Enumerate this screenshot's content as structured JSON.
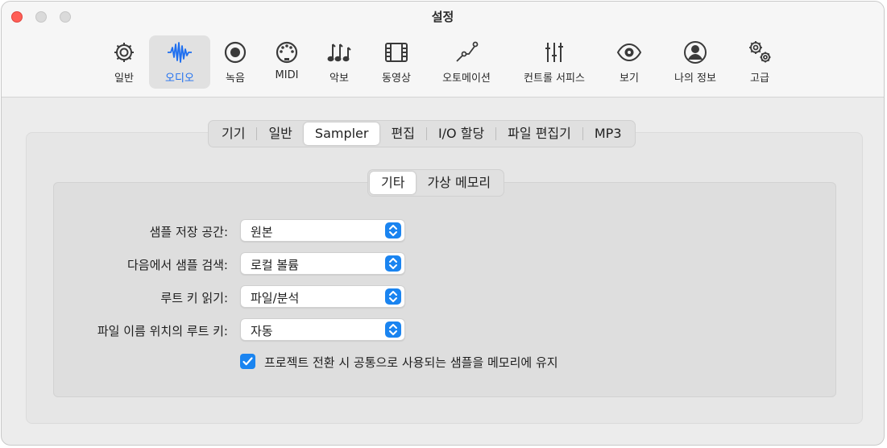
{
  "window": {
    "title": "설정"
  },
  "toolbar": {
    "items": [
      {
        "label": "일반",
        "icon": "gear-icon"
      },
      {
        "label": "오디오",
        "icon": "waveform-icon",
        "active": true
      },
      {
        "label": "녹음",
        "icon": "record-icon"
      },
      {
        "label": "MIDI",
        "icon": "midi-port-icon"
      },
      {
        "label": "악보",
        "icon": "music-notes-icon"
      },
      {
        "label": "동영상",
        "icon": "film-icon"
      },
      {
        "label": "오토메이션",
        "icon": "automation-curve-icon"
      },
      {
        "label": "컨트롤 서피스",
        "icon": "faders-icon"
      },
      {
        "label": "보기",
        "icon": "eye-icon"
      },
      {
        "label": "나의 정보",
        "icon": "person-icon"
      },
      {
        "label": "고급",
        "icon": "gears-icon"
      }
    ]
  },
  "tabs": [
    "기기",
    "일반",
    "Sampler",
    "편집",
    "I/O 할당",
    "파일 편집기",
    "MP3"
  ],
  "subtabs": [
    "기타",
    "가상 메모리"
  ],
  "form": {
    "rows": [
      {
        "label": "샘플 저장 공간:",
        "value": "원본"
      },
      {
        "label": "다음에서 샘플 검색:",
        "value": "로컬 볼륨"
      },
      {
        "label": "루트 키 읽기:",
        "value": "파일/분석"
      },
      {
        "label": "파일 이름 위치의 루트 키:",
        "value": "자동"
      }
    ],
    "checkbox": {
      "label": "프로젝트 전환 시 공통으로 사용되는 샘플을 메모리에 유지",
      "checked": true
    }
  },
  "colors": {
    "accent": "#1a84f0",
    "close": "#ff5f57"
  }
}
